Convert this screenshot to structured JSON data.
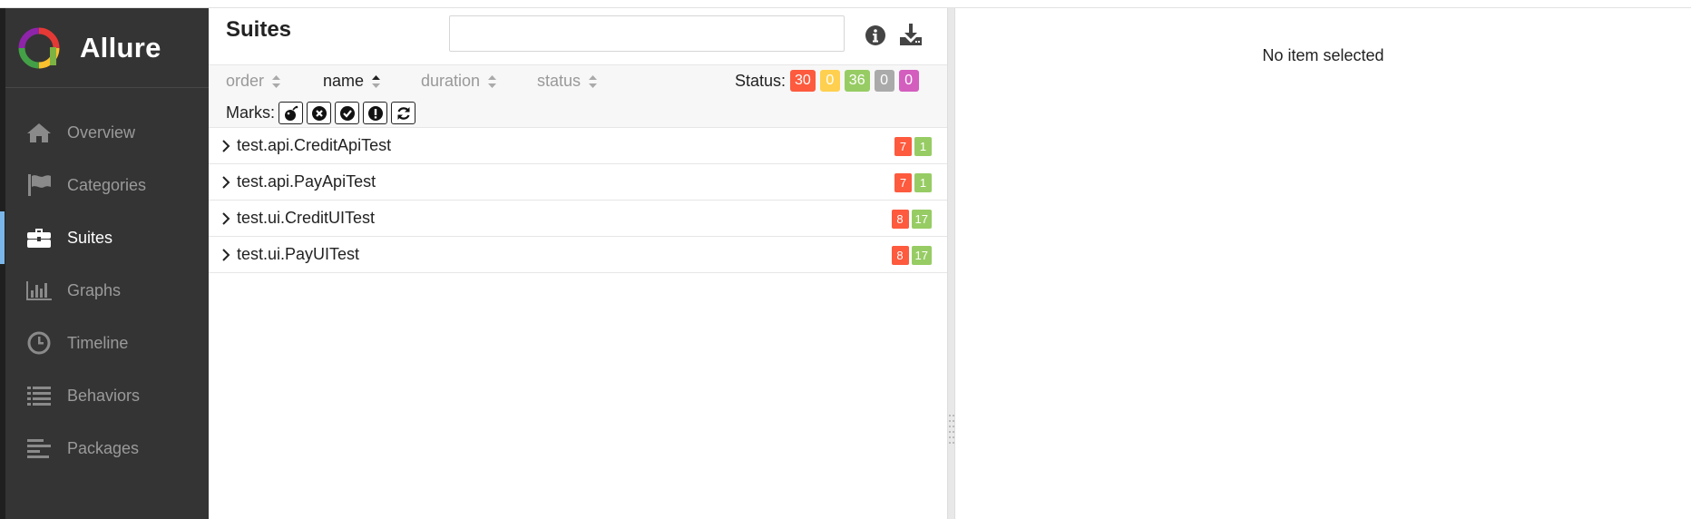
{
  "app": {
    "name": "Allure"
  },
  "sidebar": {
    "items": [
      {
        "label": "Overview",
        "icon": "home-icon",
        "active": false
      },
      {
        "label": "Categories",
        "icon": "flag-icon",
        "active": false
      },
      {
        "label": "Suites",
        "icon": "briefcase-icon",
        "active": true
      },
      {
        "label": "Graphs",
        "icon": "bar-chart-icon",
        "active": false
      },
      {
        "label": "Timeline",
        "icon": "clock-icon",
        "active": false
      },
      {
        "label": "Behaviors",
        "icon": "list-icon",
        "active": false
      },
      {
        "label": "Packages",
        "icon": "align-left-icon",
        "active": false
      }
    ]
  },
  "suites": {
    "title": "Suites",
    "search": {
      "value": "",
      "placeholder": ""
    },
    "sort": [
      {
        "label": "order",
        "active": false
      },
      {
        "label": "name",
        "active": true,
        "direction": "ascending"
      },
      {
        "label": "duration",
        "active": false
      },
      {
        "label": "status",
        "active": false
      }
    ],
    "status_label": "Status:",
    "status_counts": [
      {
        "value": "30",
        "status": "failed",
        "color": "#fd5a3e"
      },
      {
        "value": "0",
        "status": "broken",
        "color": "#ffd050"
      },
      {
        "value": "36",
        "status": "passed",
        "color": "#97cc64"
      },
      {
        "value": "0",
        "status": "skipped",
        "color": "#aaaaaa"
      },
      {
        "value": "0",
        "status": "unknown",
        "color": "#d35ebe"
      }
    ],
    "marks_label": "Marks:",
    "marks": [
      "bomb-icon",
      "times-circle-icon",
      "check-circle-icon",
      "exclamation-circle-icon",
      "refresh-icon"
    ],
    "rows": [
      {
        "name": "test.api.CreditApiTest",
        "failed": "7",
        "passed": "1"
      },
      {
        "name": "test.api.PayApiTest",
        "failed": "7",
        "passed": "1"
      },
      {
        "name": "test.ui.CreditUITest",
        "failed": "8",
        "passed": "17"
      },
      {
        "name": "test.ui.PayUITest",
        "failed": "8",
        "passed": "17"
      }
    ]
  },
  "detail": {
    "empty_text": "No item selected"
  },
  "colors": {
    "sidebar_bg": "#343434",
    "active_indicator": "#7ab6ea",
    "failed": "#fd5a3e",
    "broken": "#ffd050",
    "passed": "#97cc64",
    "skipped": "#aaaaaa",
    "unknown": "#d35ebe"
  }
}
